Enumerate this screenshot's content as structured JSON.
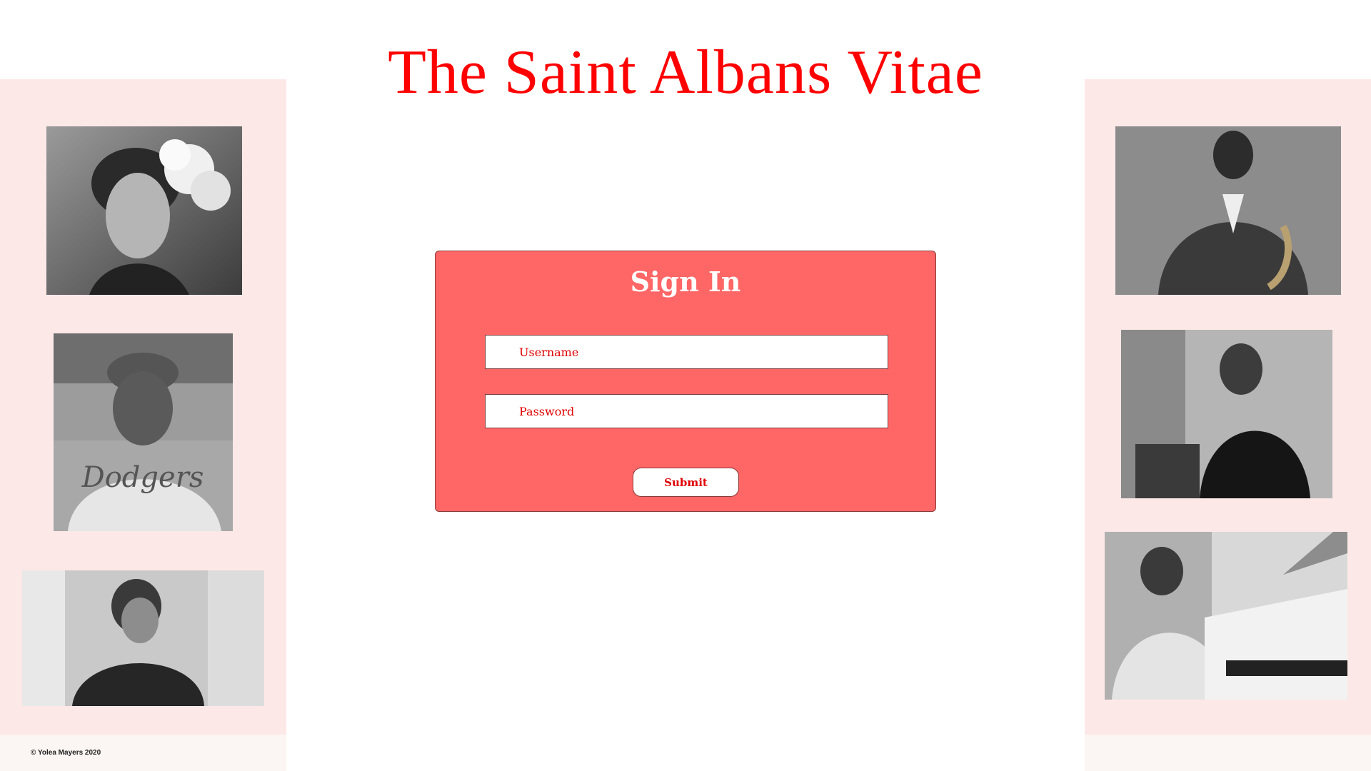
{
  "site": {
    "title": "The Saint Albans Vitae",
    "copyright": "© Yolea Mayers 2020"
  },
  "signin": {
    "title": "Sign In",
    "username_placeholder": "Username",
    "password_placeholder": "Password",
    "submit_label": "Submit"
  },
  "colors": {
    "accent": "#ff0000",
    "card_background": "#ff6666",
    "side_panel": "#fde8e8"
  },
  "photos": [
    "portrait-photo-woman-with-flower",
    "portrait-photo-baseball-player",
    "portrait-photo-woman-pinstripe",
    "portrait-photo-saxophonist",
    "portrait-photo-singer-hallway",
    "portrait-photo-pianist"
  ]
}
